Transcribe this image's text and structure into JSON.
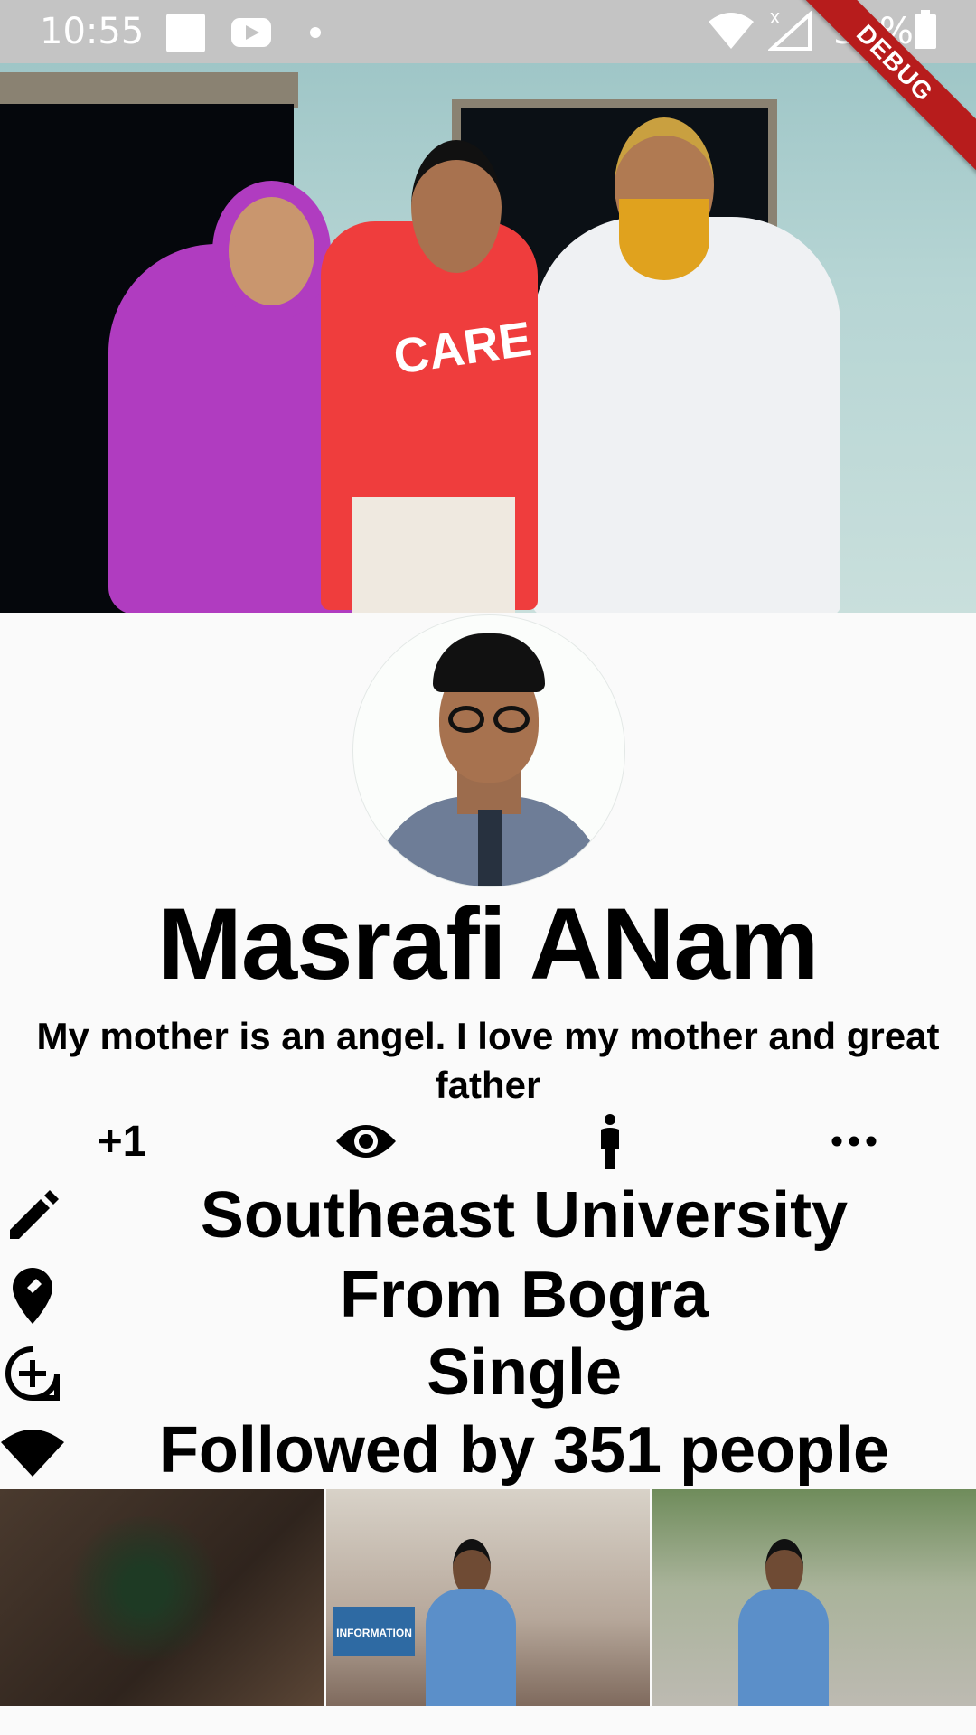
{
  "status_bar": {
    "time": "10:55",
    "battery_percent": "54%",
    "icons": [
      "notification-square-icon",
      "youtube-icon",
      "dot-icon",
      "wifi-icon",
      "signal-icon",
      "battery-icon"
    ]
  },
  "debug_banner": "DEBUG",
  "cover_photo": {
    "shirt_text": "CARE"
  },
  "profile": {
    "name": "Masrafi ANam",
    "bio": "My mother is an angel. I love my mother and great father"
  },
  "actions": {
    "plus_one": "+1",
    "icons": [
      "eye-icon",
      "person-icon",
      "more-horiz-icon"
    ]
  },
  "info": [
    {
      "icon": "edit-icon",
      "text": "Southeast University"
    },
    {
      "icon": "location-icon",
      "text": "From Bogra"
    },
    {
      "icon": "add-circle-icon",
      "text": "Single"
    },
    {
      "icon": "wifi-icon",
      "text": "Followed by 351 people"
    }
  ],
  "gallery": {
    "photos": [
      "photo-tree",
      "photo-mall",
      "photo-street"
    ],
    "sign_text": "INFORMATION"
  },
  "colors": {
    "status_bar": "#c4c4c4",
    "background": "#fafafa",
    "debug_banner": "#b71c1c",
    "text": "#000000"
  }
}
